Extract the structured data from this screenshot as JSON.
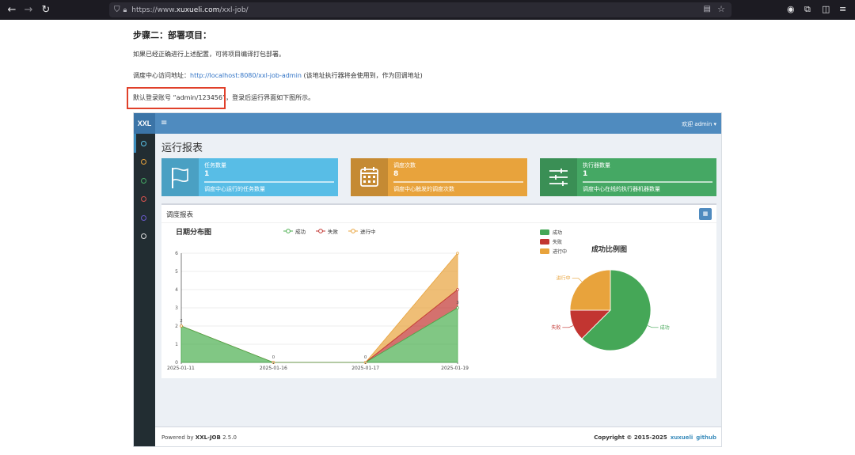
{
  "browser": {
    "url_prefix": "https://www.",
    "url_domain": "xuxueli.com",
    "url_path": "/xxl-job/"
  },
  "doc": {
    "heading": "步骤二：部署项目：",
    "para1": "如果已经正确进行上述配置，可将项目编译打包部署。",
    "para2_prefix": "调度中心访问地址：",
    "para2_link": "http://localhost:8080/xxl-job-admin",
    "para2_suffix": " (该地址执行器将会使用到，作为回调地址)",
    "para3": "默认登录账号 “admin/123456”，登录后运行界面如下图所示。"
  },
  "app": {
    "logo": "XXL",
    "menu_icon": "≡",
    "welcome": "欢迎 admin ▾",
    "page_title": "运行报表",
    "cards": [
      {
        "label": "任务数量",
        "value": "1",
        "desc": "调度中心运行的任务数量",
        "color": "#58bde6",
        "icon": "flag-icon"
      },
      {
        "label": "调度次数",
        "value": "8",
        "desc": "调度中心触发的调度次数",
        "color": "#e8a33c",
        "icon": "calendar-icon"
      },
      {
        "label": "执行器数量",
        "value": "1",
        "desc": "调度中心在线的执行器机器数量",
        "color": "#45a864",
        "icon": "sliders-icon"
      }
    ],
    "report_title": "调度报表",
    "footer": {
      "powered_prefix": "Powered by ",
      "powered_brand": "XXL-JOB",
      "version": " 2.5.0",
      "copyright": "Copyright © 2015-2025",
      "link1": "xuxueli",
      "link2": "github"
    }
  },
  "chart_data": [
    {
      "type": "area",
      "title": "日期分布图",
      "categories": [
        "2025-01-11",
        "2025-01-16",
        "2025-01-17",
        "2025-01-19"
      ],
      "stacked": true,
      "series": [
        {
          "name": "成功",
          "values": [
            2,
            0,
            0,
            3
          ],
          "color": "#4caf50"
        },
        {
          "name": "失败",
          "values": [
            0,
            0,
            0,
            1
          ],
          "color": "#c23531"
        },
        {
          "name": "进行中",
          "values": [
            0,
            0,
            0,
            2
          ],
          "color": "#e8a33c"
        }
      ],
      "data_labels": [
        "2",
        "0",
        "0",
        "3"
      ],
      "ylim": [
        0,
        6
      ],
      "yticks": [
        0,
        1,
        2,
        3,
        4,
        5,
        6
      ],
      "grid": true,
      "legend": "top"
    },
    {
      "type": "pie",
      "title": "成功比例图",
      "slices": [
        {
          "name": "成功",
          "value": 5,
          "color": "#45a757"
        },
        {
          "name": "失败",
          "value": 1,
          "color": "#c23531"
        },
        {
          "name": "进行中",
          "value": 2,
          "color": "#e8a33c"
        }
      ],
      "legend": "top-left"
    }
  ]
}
